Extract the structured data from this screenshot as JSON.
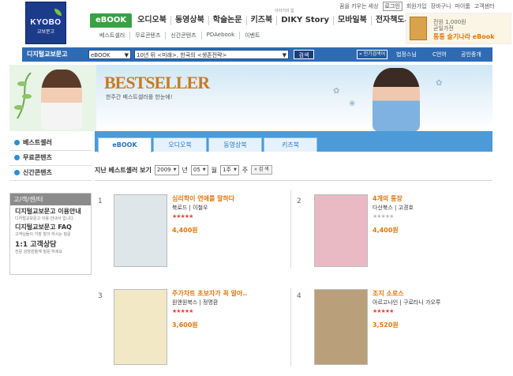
{
  "logo": {
    "line1": "KYOBO",
    "line2": "교보문고"
  },
  "util_links": [
    "꿈을 키우는 세상",
    "로그인",
    "회원가입",
    "장바구니",
    "마이룸",
    "고객센터"
  ],
  "main_nav": [
    "eBOOK",
    "오디오북",
    "동영상북",
    "학술논문",
    "키즈북",
    "DIKY Story",
    "모바일북",
    "전자책도서관"
  ],
  "diky_small": "이야기의 힘",
  "sub_nav": [
    "베스트셀러",
    "무료콘텐츠",
    "신간콘텐츠",
    "PDAebook",
    "이벤트"
  ],
  "promo": {
    "line1": "전원 1,000원",
    "line2": "균일가전",
    "line3": "통통 술기나라 eBook"
  },
  "search": {
    "title": "디지털교보문고",
    "category": "eBOOK",
    "query": "10년 뒤 <미래>, 한국의 <생존전략>",
    "button": "검색",
    "popular": "인기검색어",
    "keywords": [
      "법정스님",
      "C언어",
      "공인중개"
    ]
  },
  "banner": {
    "title": "BESTSELLER",
    "subtitle": "한주간 베스트셀러를 한눈에!"
  },
  "sidebar": {
    "items": [
      "베스트셀러",
      "무료콘텐츠",
      "신간콘텐츠"
    ],
    "cs_title": "고/객/센/터",
    "cs_entries": [
      {
        "title": "디지털교보문고 이용안내",
        "desc": "디지털교보문고 이용 안내서 입니다."
      },
      {
        "title": "디지털교보문고 FAQ",
        "desc": "고객님들이 가장 많이 하시는 질문"
      },
      {
        "title": "1:1 고객상담",
        "desc": "전문 상담원들께 질문 하세요"
      }
    ]
  },
  "tabs": [
    "eBOOK",
    "오디오북",
    "동영상북",
    "키즈북"
  ],
  "filter": {
    "label": "지난 베스트셀러 보기",
    "year": "2009",
    "year_unit": "년",
    "month": "05",
    "month_unit": "월",
    "week": "1주",
    "week_unit": "주",
    "button": "검 색"
  },
  "books": [
    {
      "rank": "1",
      "title": "심리학이 연애를 말하다",
      "meta": "북로드 | 이철우",
      "rating": 5,
      "price": "4,400원",
      "cover_color": "#dfe6ea"
    },
    {
      "rank": "2",
      "title": "4개의 통장",
      "meta": "다산북스 | 고경호",
      "rating": 0,
      "price": "4,400원",
      "cover_color": "#e9b9c4"
    },
    {
      "rank": "3",
      "title": "주가차트 초보자가 꼭 알아..",
      "meta": "원앤원북스 | 정명환",
      "rating": 5,
      "price": "3,600원",
      "cover_color": "#f2e8c6"
    },
    {
      "rank": "4",
      "title": "조지 소로스",
      "meta": "아르고나인 | 구로타니 가오루",
      "rating": 5,
      "price": "3,520원",
      "cover_color": "#b9a07a"
    }
  ],
  "colors": {
    "accent": "#2e6bb5",
    "orange": "#e3760b",
    "green": "#3aa043"
  }
}
